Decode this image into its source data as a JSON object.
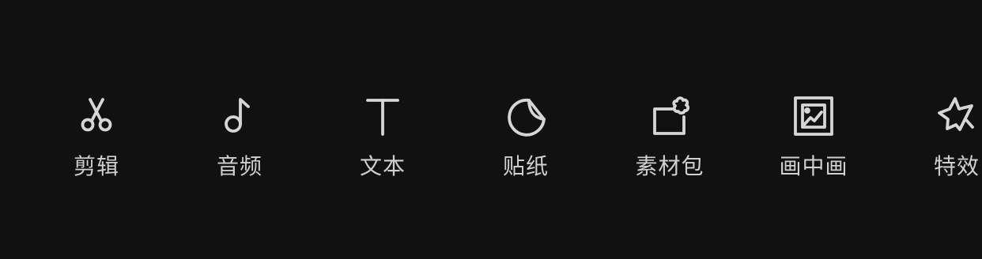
{
  "toolbar": {
    "items": [
      {
        "label": "剪辑",
        "icon": "scissors-icon"
      },
      {
        "label": "音频",
        "icon": "music-note-icon"
      },
      {
        "label": "文本",
        "icon": "text-icon"
      },
      {
        "label": "贴纸",
        "icon": "sticker-icon"
      },
      {
        "label": "素材包",
        "icon": "material-pack-icon"
      },
      {
        "label": "画中画",
        "icon": "picture-in-picture-icon"
      },
      {
        "label": "特效",
        "icon": "effects-star-icon"
      }
    ]
  },
  "colors": {
    "background": "#111111",
    "icon": "#d6d6d6",
    "label": "#d0d0d0"
  }
}
